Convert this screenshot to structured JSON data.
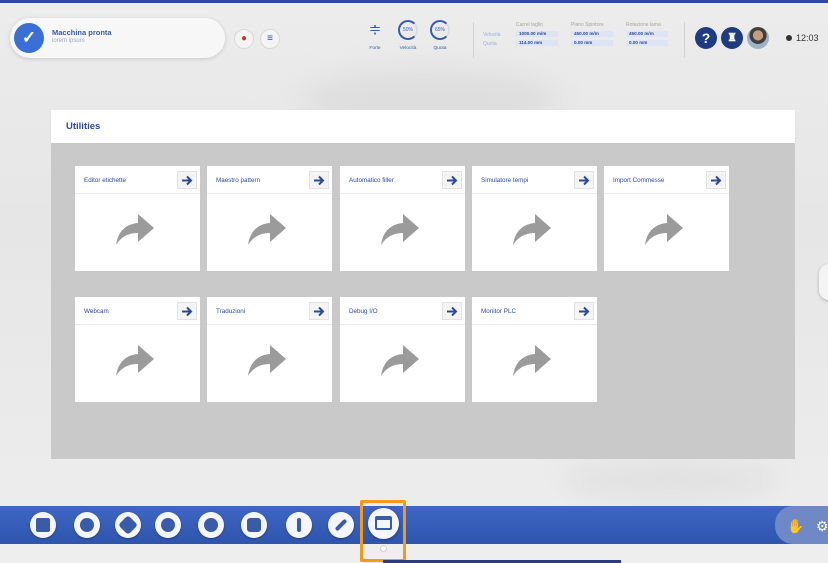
{
  "header": {
    "status": {
      "title": "Macchina pronta",
      "subtitle": "lorem ipsum"
    },
    "tools": [
      {
        "id": "forte",
        "label": "Forte"
      },
      {
        "id": "velocita",
        "label": "Velocità",
        "value": "50%"
      },
      {
        "id": "quota",
        "label": "Quota",
        "value": "65%"
      }
    ],
    "stats": {
      "columns": [
        "Carrel taglio",
        "Piano Spintore",
        "Rotazione lama"
      ],
      "rows": [
        {
          "label": "Velocità",
          "values": [
            "1000.00 m/m",
            "450.00 m/m",
            "450.00 m/m"
          ]
        },
        {
          "label": "Quota",
          "values": [
            "114.00 mm",
            "0.00 mm",
            "0.00 mm"
          ]
        }
      ]
    },
    "help_label": "?",
    "clock": "12:03"
  },
  "utilities": {
    "title": "Utilities",
    "tiles": [
      {
        "label": "Editor etichette"
      },
      {
        "label": "Maestro pattern"
      },
      {
        "label": "Automatico filler"
      },
      {
        "label": "Simulatore tempi"
      },
      {
        "label": "Import Commesse"
      },
      {
        "label": "Webcam"
      },
      {
        "label": "Traduzioni"
      },
      {
        "label": "Debug I/O"
      },
      {
        "label": "Monitor PLC"
      }
    ]
  },
  "toolbar": {
    "buttons": [
      "home-icon",
      "edit-icon",
      "move-icon",
      "network-icon",
      "settings-icon",
      "stats-icon",
      "warning-icon",
      "wrench-icon",
      "monitor-icon"
    ],
    "active": "monitor-icon"
  },
  "colors": {
    "accent": "#3a5ba8",
    "toolbar": "#3d67c4",
    "highlight": "#f29a1c"
  }
}
